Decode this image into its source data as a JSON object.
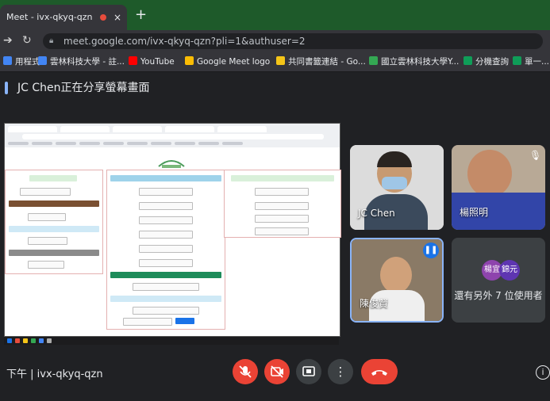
{
  "browser": {
    "tab_title": "Meet - ivx-qkyq-qzn",
    "tab_close": "×",
    "new_tab": "+",
    "url": "meet.google.com/ivx-qkyq-qzn?pli=1&authuser=2",
    "bookmarks": [
      {
        "label": "用程式",
        "color": "#4285f4"
      },
      {
        "label": "雲林科技大學 - 註...",
        "color": "#4285f4"
      },
      {
        "label": "YouTube",
        "color": "#ff0000"
      },
      {
        "label": "Google Meet logo",
        "color": "#fbbc04"
      },
      {
        "label": "共同書籤連結 - Go...",
        "color": "#f5c518"
      },
      {
        "label": "國立雲林科技大學Y...",
        "color": "#34a853"
      },
      {
        "label": "分機查詢",
        "color": "#0f9d58"
      },
      {
        "label": "單一...",
        "color": "#0f9d58"
      }
    ]
  },
  "meet": {
    "presenting_text": "JC Chen正在分享螢幕畫面",
    "meeting_code": "下午 | ivx-qkyq-qzn",
    "participants": [
      {
        "name": "JC Chen"
      },
      {
        "name": "楊照明"
      },
      {
        "name": "陳俊賢"
      }
    ],
    "others": {
      "avatar1": "楊宜",
      "avatar2": "錦元",
      "label": "還有另外 7 位使用者"
    },
    "colors": {
      "hangup": "#ea4335",
      "muted": "#ea4335",
      "accent": "#8ab4f8"
    }
  },
  "controls": {
    "mic_icon": "mic-off",
    "cam_icon": "camera-off",
    "present_icon": "present",
    "more_icon": "⋮",
    "hangup_icon": "call-end",
    "info_icon": "i"
  }
}
